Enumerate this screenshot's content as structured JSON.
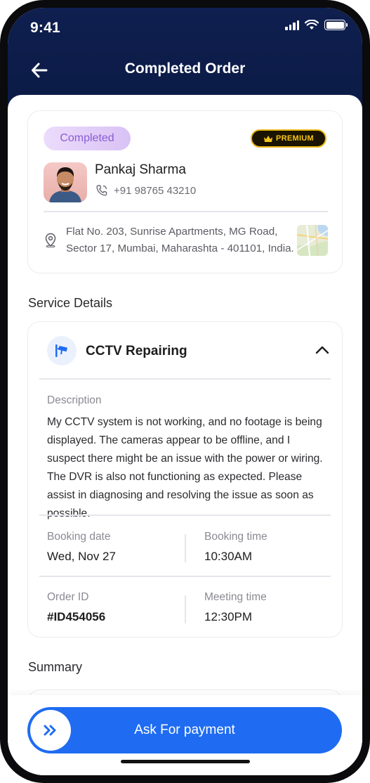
{
  "status_bar": {
    "time": "9:41"
  },
  "header": {
    "title": "Completed Order"
  },
  "customer": {
    "status_badge": "Completed",
    "premium_badge": "PREMIUM",
    "name": "Pankaj Sharma",
    "phone": "+91 98765 43210",
    "address_line1": "Flat No. 203, Sunrise Apartments, MG Road,",
    "address_line2": "Sector 17, Mumbai, Maharashta - 401101, India."
  },
  "service_section": {
    "title": "Service Details",
    "service_name": "CCTV Repairing",
    "description_label": "Description",
    "description": "My CCTV system is not working, and no footage is being displayed. The cameras appear to be offline, and I suspect there might be an issue with the power or wiring. The DVR is also not functioning as expected. Please assist in diagnosing and resolving the issue as soon as possible.",
    "booking_date_label": "Booking date",
    "booking_date": "Wed, Nov 27",
    "booking_time_label": "Booking time",
    "booking_time": "10:30AM",
    "order_id_label": "Order ID",
    "order_id": "#ID454056",
    "meeting_time_label": "Meeting time",
    "meeting_time": "12:30PM"
  },
  "summary_section": {
    "title": "Summary"
  },
  "action": {
    "pay_label": "Ask For payment"
  },
  "colors": {
    "header_bg": "#0f1f4f",
    "primary": "#1f6cf2",
    "completed_badge_text": "#8b5bd6",
    "premium_gold": "#f5c518"
  },
  "icons": {
    "back": "arrow-left-icon",
    "phone": "phone-icon",
    "location": "location-pin-icon",
    "service": "cctv-camera-icon",
    "collapse": "chevron-up-icon",
    "pay": "double-chevron-right-icon",
    "premium": "crown-icon"
  }
}
